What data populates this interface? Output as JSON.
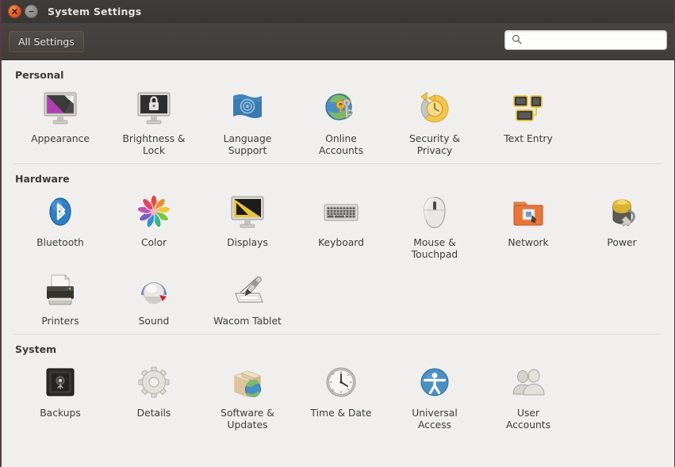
{
  "window": {
    "title": "System Settings",
    "close_icon": "close-icon",
    "minimize_icon": "minimize-icon",
    "accent_color": "#e2582a",
    "titlebar_color": "#3e3a38",
    "content_bg": "#f0efee"
  },
  "toolbar": {
    "all_settings_label": "All Settings",
    "search": {
      "icon": "search-icon",
      "value": "",
      "placeholder": ""
    }
  },
  "sections": [
    {
      "title": "Personal",
      "items": [
        {
          "label": "Appearance",
          "icon": "appearance-icon"
        },
        {
          "label": "Brightness &\nLock",
          "icon": "brightness-lock-icon"
        },
        {
          "label": "Language\nSupport",
          "icon": "language-support-icon"
        },
        {
          "label": "Online\nAccounts",
          "icon": "online-accounts-icon"
        },
        {
          "label": "Security &\nPrivacy",
          "icon": "security-privacy-icon"
        },
        {
          "label": "Text Entry",
          "icon": "text-entry-icon"
        }
      ]
    },
    {
      "title": "Hardware",
      "items": [
        {
          "label": "Bluetooth",
          "icon": "bluetooth-icon"
        },
        {
          "label": "Color",
          "icon": "color-icon"
        },
        {
          "label": "Displays",
          "icon": "displays-icon"
        },
        {
          "label": "Keyboard",
          "icon": "keyboard-icon"
        },
        {
          "label": "Mouse &\nTouchpad",
          "icon": "mouse-touchpad-icon"
        },
        {
          "label": "Network",
          "icon": "network-icon"
        },
        {
          "label": "Power",
          "icon": "power-icon"
        },
        {
          "label": "Printers",
          "icon": "printers-icon"
        },
        {
          "label": "Sound",
          "icon": "sound-icon"
        },
        {
          "label": "Wacom Tablet",
          "icon": "wacom-tablet-icon"
        }
      ]
    },
    {
      "title": "System",
      "items": [
        {
          "label": "Backups",
          "icon": "backups-icon"
        },
        {
          "label": "Details",
          "icon": "details-icon"
        },
        {
          "label": "Software &\nUpdates",
          "icon": "software-updates-icon"
        },
        {
          "label": "Time & Date",
          "icon": "time-date-icon"
        },
        {
          "label": "Universal\nAccess",
          "icon": "universal-access-icon"
        },
        {
          "label": "User\nAccounts",
          "icon": "user-accounts-icon"
        }
      ]
    }
  ]
}
